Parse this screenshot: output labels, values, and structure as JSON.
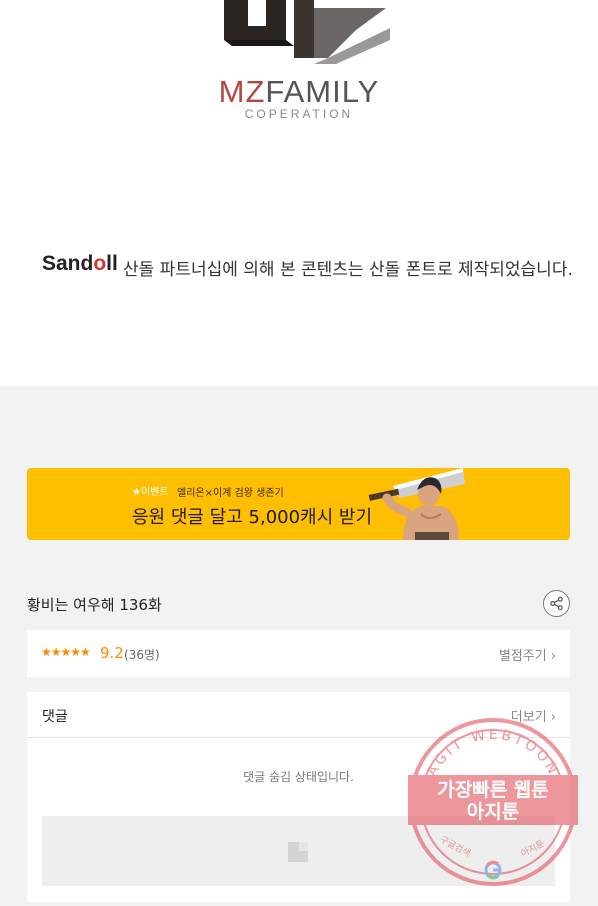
{
  "brand": {
    "mz": "MZ",
    "family": "FAMILY",
    "sub": "COPERATION"
  },
  "credit": {
    "logo_prefix": "Sand",
    "logo_o": "o",
    "logo_suffix": "ll",
    "text": "산돌 파트너십에 의해 본 콘텐츠는 산돌 폰트로 제작되었습니다."
  },
  "banner": {
    "tag": "★이벤트",
    "subtitle": "엘리온×이계 검왕 생존기",
    "title": "응원 댓글 달고 5,000캐시 받기",
    "color": "#ffbe00"
  },
  "episode": {
    "title": "황비는 여우해 136화"
  },
  "rating": {
    "stars": "★★★★★",
    "score": "9.2",
    "count": "(36명)",
    "action_label": "별점주기 ›",
    "accent": "#ff8a00"
  },
  "comments": {
    "title": "댓글",
    "more_label": "더보기 ›",
    "hidden_message": "댓글 숨김 상태입니다."
  },
  "watermark": {
    "ring_text": "AGIT WEBTOON",
    "line1": "가장빠른 웹툰",
    "line2": "아지툰",
    "bottom_left": "구글검색",
    "bottom_right": "아지툰",
    "color": "#e0434e"
  },
  "icons": {
    "share": "share-icon",
    "image_placeholder": "image-placeholder-icon"
  }
}
